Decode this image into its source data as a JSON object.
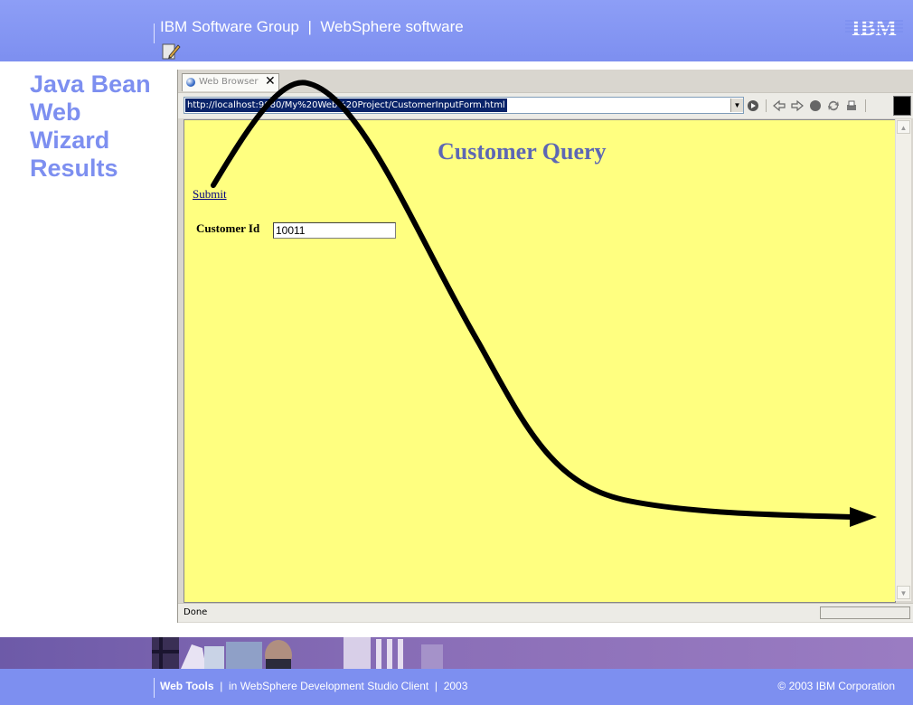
{
  "header": {
    "group_text": "IBM Software Group  |  WebSphere software",
    "logo": "IBM"
  },
  "slide": {
    "title_lines": [
      "Java Bean",
      "Web",
      "Wizard",
      "Results"
    ]
  },
  "browser": {
    "tab_label": "Web Browser",
    "tab_close": "✕",
    "url": "http://localhost:9080/My%20Web%20Project/CustomerInputForm.html",
    "url_dropdown": "▼",
    "toolbar_icons": [
      "go-icon",
      "back-icon",
      "forward-icon",
      "stop-icon",
      "refresh-icon",
      "print-icon"
    ],
    "status": "Done"
  },
  "page": {
    "title": "Customer Query",
    "submit_link": "Submit",
    "customer_id_label": "Customer Id",
    "customer_id_value": "10011"
  },
  "footer": {
    "product_bold": "Web Tools",
    "product_rest": "  |  in WebSphere Development Studio Client  |  2003",
    "copyright": "© 2003 IBM Corporation"
  },
  "colors": {
    "header_blue": "#7d8ff0",
    "page_background": "#ffff80",
    "page_title": "#5d67b4",
    "arrow": "#000000"
  }
}
